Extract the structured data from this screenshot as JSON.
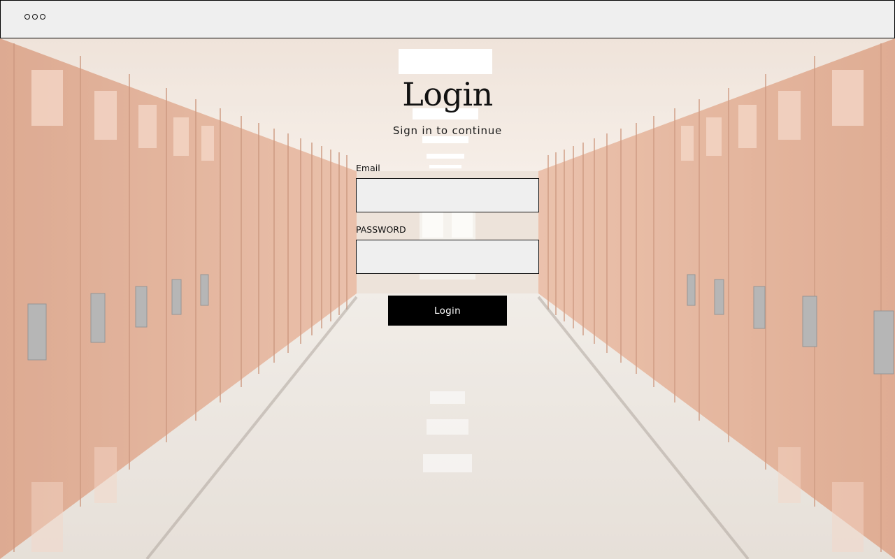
{
  "window": {
    "controls_icon": "more-horizontal-icon"
  },
  "login": {
    "title": "Login",
    "subtitle": "Sign in to continue",
    "email_label": "Email",
    "email_value": "",
    "password_label": "PASSWORD",
    "password_value": "",
    "submit_label": "Login"
  },
  "colors": {
    "chrome_background": "#efefef",
    "button_background": "#000000",
    "button_text": "#ffffff",
    "input_background": "#efefef"
  }
}
